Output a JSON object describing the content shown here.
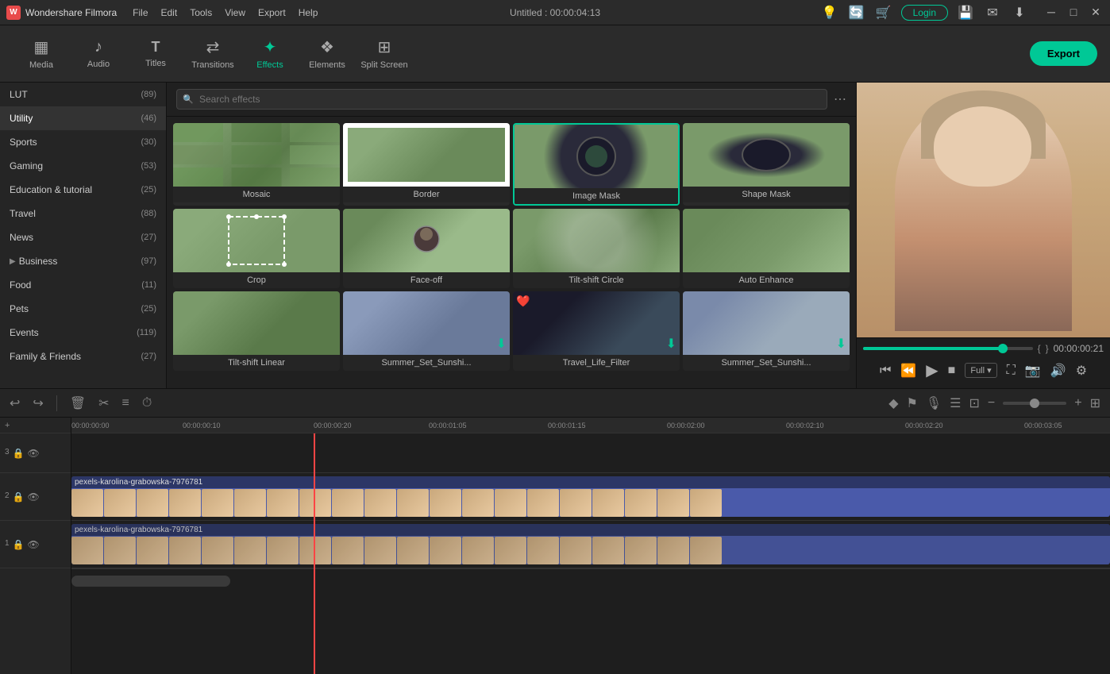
{
  "app": {
    "name": "Wondershare Filmora",
    "title": "Untitled : 00:00:04:13"
  },
  "menu": {
    "items": [
      "File",
      "Edit",
      "Tools",
      "View",
      "Export",
      "Help"
    ]
  },
  "toolbar": {
    "items": [
      {
        "id": "media",
        "label": "Media",
        "icon": "▦"
      },
      {
        "id": "audio",
        "label": "Audio",
        "icon": "♪"
      },
      {
        "id": "titles",
        "label": "Titles",
        "icon": "T"
      },
      {
        "id": "transitions",
        "label": "Transitions",
        "icon": "⇄"
      },
      {
        "id": "effects",
        "label": "Effects",
        "icon": "✦"
      },
      {
        "id": "elements",
        "label": "Elements",
        "icon": "❖"
      },
      {
        "id": "splitscreen",
        "label": "Split Screen",
        "icon": "⊞"
      }
    ],
    "active": "effects",
    "export_label": "Export"
  },
  "sidebar": {
    "categories": [
      {
        "name": "LUT",
        "count": 89
      },
      {
        "name": "Utility",
        "count": 46,
        "active": true
      },
      {
        "name": "Sports",
        "count": 30
      },
      {
        "name": "Gaming",
        "count": 53
      },
      {
        "name": "Education & tutorial",
        "count": 25
      },
      {
        "name": "Travel",
        "count": 88
      },
      {
        "name": "News",
        "count": 27
      },
      {
        "name": "Business",
        "count": 97,
        "hasArrow": true
      },
      {
        "name": "Food",
        "count": 11
      },
      {
        "name": "Pets",
        "count": 25
      },
      {
        "name": "Events",
        "count": 119
      },
      {
        "name": "Family & Friends",
        "count": 27
      }
    ]
  },
  "search": {
    "placeholder": "Search effects"
  },
  "effects": {
    "items": [
      {
        "name": "Mosaic",
        "thumb": "vineyard",
        "selected": false,
        "badge": null
      },
      {
        "name": "Border",
        "thumb": "border",
        "selected": false,
        "badge": null
      },
      {
        "name": "Image Mask",
        "thumb": "mask",
        "selected": true,
        "badge": null
      },
      {
        "name": "Shape Mask",
        "thumb": "shape",
        "selected": false,
        "badge": null
      },
      {
        "name": "Crop",
        "thumb": "dashed",
        "selected": false,
        "badge": null
      },
      {
        "name": "Face-off",
        "thumb": "faceoff",
        "selected": false,
        "badge": null
      },
      {
        "name": "Tilt-shift Circle",
        "thumb": "circle-blur",
        "selected": false,
        "badge": null
      },
      {
        "name": "Auto Enhance",
        "thumb": "vineyard2",
        "selected": false,
        "badge": null
      },
      {
        "name": "Tilt-shift Linear",
        "thumb": "tiltlinear",
        "selected": false,
        "badge": null
      },
      {
        "name": "Summer_Set_Sunshi...",
        "thumb": "summer1",
        "selected": false,
        "badge": null,
        "download": true
      },
      {
        "name": "Travel_Life_Filter",
        "thumb": "bike",
        "selected": false,
        "badge": "heart",
        "download": true
      },
      {
        "name": "Summer_Set_Sunshi...",
        "thumb": "summer2",
        "selected": false,
        "badge": null,
        "download": true
      }
    ]
  },
  "preview": {
    "time": "00:00:00:21",
    "progress": 85,
    "quality": "Full",
    "bracket_start": "{",
    "bracket_end": "}"
  },
  "timeline": {
    "current_time": "00:00:20",
    "zoom": 50,
    "markers": [
      "00:00:00:00",
      "00:00:00:10",
      "00:00:00:20",
      "00:00:01:05",
      "00:00:01:15",
      "00:00:02:00",
      "00:00:02:10",
      "00:00:02:20",
      "00:00:03:05"
    ],
    "tracks": [
      {
        "id": 3,
        "type": "empty",
        "label": ""
      },
      {
        "id": 2,
        "type": "clip",
        "clip_name": "pexels-karolina-grabowska-7976781",
        "color": "#4a5aaa"
      },
      {
        "id": 1,
        "type": "clip",
        "clip_name": "pexels-karolina-grabowska-7976781",
        "color": "#4a5aaa"
      }
    ]
  }
}
